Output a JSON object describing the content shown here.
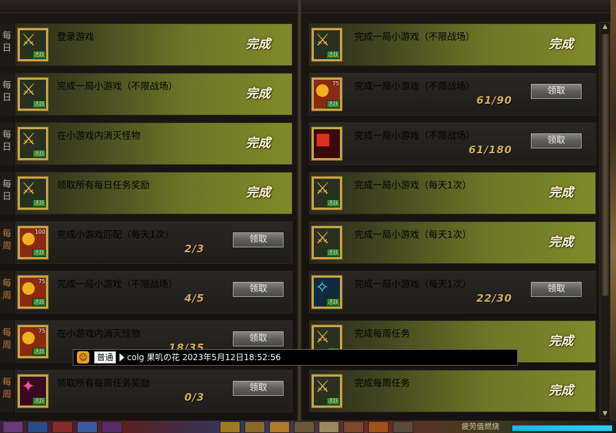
{
  "left_tasks": [
    {
      "tag": "每日",
      "title": "登录游戏",
      "state": "done",
      "status": "完成",
      "progress": "",
      "button": "",
      "icon_name": "sword-event-icon",
      "icon_num": "",
      "badge": "活跃"
    },
    {
      "tag": "每日",
      "title": "完成一局小游戏（不限战场）",
      "state": "done",
      "status": "完成",
      "progress": "",
      "button": "",
      "icon_name": "sword-event-icon",
      "icon_num": "",
      "badge": "活跃"
    },
    {
      "tag": "每日",
      "title": "在小游戏内消灭怪物",
      "state": "done",
      "status": "完成",
      "progress": "",
      "button": "",
      "icon_name": "sword-event-icon",
      "icon_num": "",
      "badge": "活跃"
    },
    {
      "tag": "每日",
      "title": "领取所有每日任务奖励",
      "state": "done",
      "status": "完成",
      "progress": "",
      "button": "",
      "icon_name": "sword-event-icon",
      "icon_num": "",
      "badge": "活跃"
    },
    {
      "tag": "每周",
      "title": "完成小游戏匹配（每天1次）",
      "state": "todo",
      "status": "",
      "progress": "2/3",
      "button": "领取",
      "icon_name": "coin-event-icon",
      "icon_num": "100",
      "badge": "活跃"
    },
    {
      "tag": "每周",
      "title": "完成一局小游戏（不限战场）",
      "state": "todo",
      "status": "",
      "progress": "4/5",
      "button": "领取",
      "icon_name": "coin-event-icon",
      "icon_num": "75",
      "badge": "活跃"
    },
    {
      "tag": "每周",
      "title": "在小游戏内消灭怪物",
      "state": "todo",
      "status": "",
      "progress": "18/35",
      "button": "领取",
      "icon_name": "coin-event-icon",
      "icon_num": "75",
      "badge": "活跃"
    },
    {
      "tag": "每周",
      "title": "领取所有每周任务奖励",
      "state": "todo",
      "status": "",
      "progress": "0/3",
      "button": "领取",
      "icon_name": "magic-event-icon",
      "icon_num": "",
      "badge": "活跃"
    }
  ],
  "right_tasks": [
    {
      "title": "完成一局小游戏（不限战场）",
      "state": "done",
      "status": "完成",
      "progress": "",
      "button": "",
      "icon_name": "sword-event-icon",
      "icon_num": "",
      "badge": "活跃"
    },
    {
      "title": "完成一局小游戏（不限战场）",
      "state": "todo",
      "status": "",
      "progress": "61/90",
      "button": "领取",
      "icon_name": "coin-event-icon",
      "icon_num": "75",
      "badge": "活跃"
    },
    {
      "title": "完成一局小游戏（不限战场）",
      "state": "todo",
      "status": "",
      "progress": "61/180",
      "button": "领取",
      "icon_name": "gift-box-icon",
      "icon_num": "",
      "badge": ""
    },
    {
      "title": "完成一局小游戏（每天1次）",
      "state": "done",
      "status": "完成",
      "progress": "",
      "button": "",
      "icon_name": "sword-event-icon",
      "icon_num": "",
      "badge": "活跃"
    },
    {
      "title": "完成一局小游戏（每天1次）",
      "state": "done",
      "status": "完成",
      "progress": "",
      "button": "",
      "icon_name": "sword-event-icon",
      "icon_num": "",
      "badge": "活跃"
    },
    {
      "title": "完成一局小游戏（每天1次）",
      "state": "todo",
      "status": "",
      "progress": "22/30",
      "button": "领取",
      "icon_name": "crystal-event-icon",
      "icon_num": "",
      "badge": "活跃"
    },
    {
      "title": "完成每周任务",
      "state": "done",
      "status": "完成",
      "progress": "",
      "button": "",
      "icon_name": "sword-event-icon",
      "icon_num": "",
      "badge": "活跃"
    },
    {
      "title": "完成每周任务",
      "state": "done",
      "status": "完成",
      "progress": "",
      "button": "",
      "icon_name": "sword-event-icon",
      "icon_num": "",
      "badge": "活跃"
    }
  ],
  "chat": {
    "channel": "普通",
    "message": "colg 果叽の花 2023年5月12日18:52:56"
  },
  "bottom": {
    "label": "疲劳值燃烧"
  },
  "scrollbar": {
    "up": "▲",
    "down": "▼"
  },
  "colors": {
    "done_panel": "#7f8a2c",
    "todo_panel": "#1f1d1a",
    "daily_tag": "#b9b39f",
    "weekly_tag": "#c77a3a",
    "button": "#5e5d5a"
  }
}
